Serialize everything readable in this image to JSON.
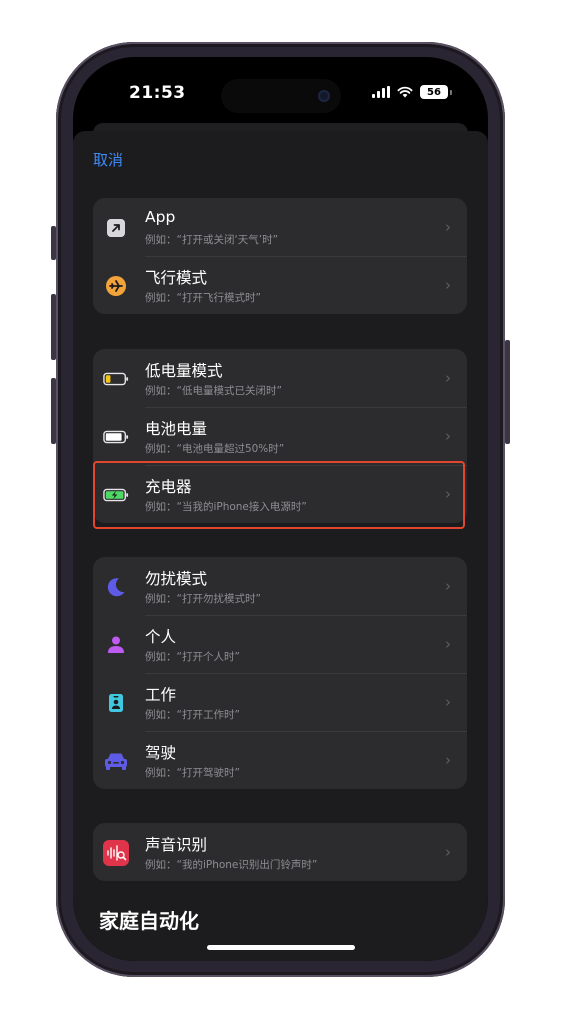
{
  "status_bar": {
    "time": "21:53",
    "battery": "56"
  },
  "nav": {
    "cancel": "取消"
  },
  "groups": [
    {
      "items": [
        {
          "title": "App",
          "subtitle": "例如：“打开或关闭‘天气’时”",
          "icon": "app-arrow-icon"
        },
        {
          "title": "飞行模式",
          "subtitle": "例如：“打开飞行模式时”",
          "icon": "airplane-icon",
          "color": "#f2a33a"
        }
      ]
    },
    {
      "items": [
        {
          "title": "低电量模式",
          "subtitle": "例如：“低电量模式已关闭时”",
          "icon": "low-battery-icon",
          "color": "#f5c518"
        },
        {
          "title": "电池电量",
          "subtitle": "例如：“电池电量超过50%时”",
          "icon": "battery-level-icon"
        },
        {
          "title": "充电器",
          "subtitle": "例如：“当我的iPhone接入电源时”",
          "icon": "charging-battery-icon",
          "color": "#4cd964"
        }
      ]
    },
    {
      "items": [
        {
          "title": "勿扰模式",
          "subtitle": "例如：“打开勿扰模式时”",
          "icon": "moon-icon",
          "color": "#5e5ce6"
        },
        {
          "title": "个人",
          "subtitle": "例如：“打开个人时”",
          "icon": "person-icon",
          "color": "#bf5af2"
        },
        {
          "title": "工作",
          "subtitle": "例如：“打开工作时”",
          "icon": "badge-icon",
          "color": "#40c8e0"
        },
        {
          "title": "驾驶",
          "subtitle": "例如：“打开驾驶时”",
          "icon": "car-icon",
          "color": "#5e5ce6"
        }
      ]
    },
    {
      "items": [
        {
          "title": "声音识别",
          "subtitle": "例如：“我的iPhone识别出门铃声时”",
          "icon": "sound-recognition-icon",
          "color": "#e0344a"
        }
      ]
    }
  ],
  "section_header": "家庭自动化",
  "chevron": "›"
}
